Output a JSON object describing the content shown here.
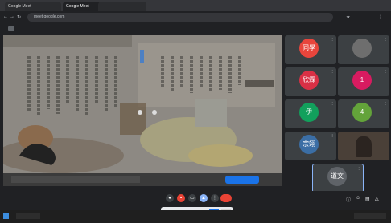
{
  "browser": {
    "tabs": [
      {
        "label": "Google Meet",
        "active": false
      },
      {
        "label": "Google Meet",
        "active": true
      }
    ],
    "url": "meet.google.com"
  },
  "meet": {
    "presenter_label": "",
    "participants": [
      {
        "name": "同學",
        "avatar_text": "同學",
        "color": "#e8453c"
      },
      {
        "name": "",
        "avatar_text": "",
        "color": "#6e6e6e"
      },
      {
        "name": "",
        "avatar_text": "欣霖",
        "color": "#d93045"
      },
      {
        "name": "",
        "avatar_text": "1",
        "color": "#d81b60"
      },
      {
        "name": "",
        "avatar_text": "伊",
        "color": "#12a05c"
      },
      {
        "name": "",
        "avatar_text": "4",
        "color": "#63a33a"
      },
      {
        "name": "",
        "avatar_text": "宗翊",
        "color": "#3b6ea5"
      },
      {
        "name": "",
        "avatar_text": "",
        "color": "#555"
      },
      {
        "name": "",
        "avatar_text": "道文",
        "color": "#5f6368"
      }
    ],
    "bottom_left": "",
    "share_button": "",
    "leave_label": ""
  }
}
